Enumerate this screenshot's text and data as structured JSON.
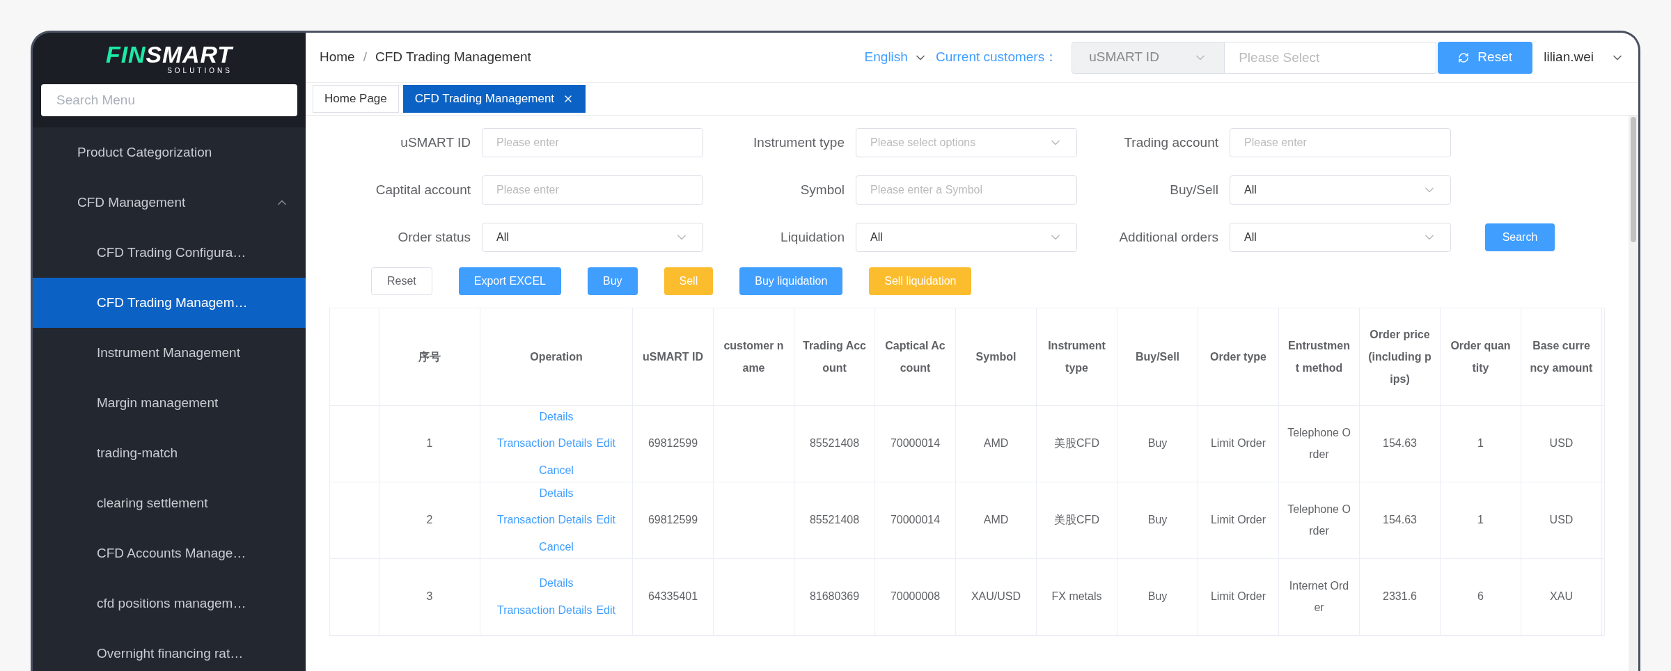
{
  "logo": {
    "part_1": "FIN",
    "part_2": "SMART",
    "tagline": "SOLUTIONS"
  },
  "sidebar": {
    "search": {
      "placeholder": "Search Menu"
    },
    "items": [
      {
        "label": "Product Categorization",
        "selected": false
      },
      {
        "label": "CFD Management",
        "selected": false,
        "expanded": true,
        "children": [
          {
            "label": "CFD Trading Configura…",
            "selected": false
          },
          {
            "label": "CFD Trading Managem…",
            "selected": true
          },
          {
            "label": "Instrument Management",
            "selected": false
          },
          {
            "label": "Margin management",
            "selected": false
          },
          {
            "label": "trading-match",
            "selected": false
          },
          {
            "label": "clearing settlement",
            "selected": false
          },
          {
            "label": "CFD Accounts Manage…",
            "selected": false
          },
          {
            "label": "cfd positions managem…",
            "selected": false
          },
          {
            "label": "Overnight financing rat…",
            "selected": false
          }
        ]
      }
    ]
  },
  "header": {
    "breadcrumb": [
      "Home",
      "CFD Trading Management"
    ],
    "separator": "/",
    "language": "English",
    "customer_label": "Current customers：",
    "customer_type": {
      "value": "uSMART ID",
      "disabled": true
    },
    "customer_select": {
      "placeholder": "Please Select"
    },
    "reset_button": "Reset",
    "user": "lilian.wei"
  },
  "tabs": [
    {
      "label": "Home Page",
      "selected": false
    },
    {
      "label": "CFD Trading Management",
      "selected": true,
      "closable": true
    }
  ],
  "filters": [
    {
      "label": "uSMART ID",
      "kind": "input",
      "placeholder": "Please enter"
    },
    {
      "label": "Instrument type",
      "kind": "select",
      "placeholder": "Please select options"
    },
    {
      "label": "Trading account",
      "kind": "input",
      "placeholder": "Please enter"
    },
    {
      "label": "Captital account",
      "kind": "input",
      "placeholder": "Please enter"
    },
    {
      "label": "Symbol",
      "kind": "input",
      "placeholder": "Please enter a Symbol"
    },
    {
      "label": "Buy/Sell",
      "kind": "select",
      "value": "All"
    },
    {
      "label": "Order status",
      "kind": "select",
      "value": "All"
    },
    {
      "label": "Liquidation",
      "kind": "select",
      "value": "All"
    },
    {
      "label": "Additional orders",
      "kind": "select",
      "value": "All"
    }
  ],
  "search_button": "Search",
  "actions": [
    {
      "label": "Reset",
      "kind": "plain"
    },
    {
      "label": "Export EXCEL",
      "kind": "primary"
    },
    {
      "label": "Buy",
      "kind": "primary"
    },
    {
      "label": "Sell",
      "kind": "warning"
    },
    {
      "label": "Buy liquidation",
      "kind": "primary"
    },
    {
      "label": "Sell liquidation",
      "kind": "warning"
    }
  ],
  "table": {
    "columns": [
      "序号",
      "Operation",
      "uSMART ID",
      "customer name",
      "Trading Account",
      "Captical Account",
      "Symbol",
      "Instrument type",
      "Buy/Sell",
      "Order type",
      "Entrustment method",
      "Order price(including pips)",
      "Order quantity",
      "Base currency amount"
    ],
    "rows": [
      {
        "cells": [
          "1",
          null,
          "69812599",
          "",
          "85521408",
          "70000014",
          "AMD",
          "美股CFD",
          "Buy",
          "Limit Order",
          "Telephone Order",
          "154.63",
          "1",
          "USD"
        ],
        "operations": [
          "Details",
          "Transaction Details",
          "Edit",
          "Cancel"
        ]
      },
      {
        "cells": [
          "2",
          null,
          "69812599",
          "",
          "85521408",
          "70000014",
          "AMD",
          "美股CFD",
          "Buy",
          "Limit Order",
          "Telephone Order",
          "154.63",
          "1",
          "USD"
        ],
        "operations": [
          "Details",
          "Transaction Details",
          "Edit",
          "Cancel"
        ]
      },
      {
        "cells": [
          "3",
          null,
          "64335401",
          "",
          "81680369",
          "70000008",
          "XAU/USD",
          "FX metals",
          "Buy",
          "Limit Order",
          "Internet Order",
          "2331.6",
          "6",
          "XAU"
        ],
        "operations": [
          "Details",
          "Transaction Details",
          "Edit"
        ]
      }
    ]
  }
}
